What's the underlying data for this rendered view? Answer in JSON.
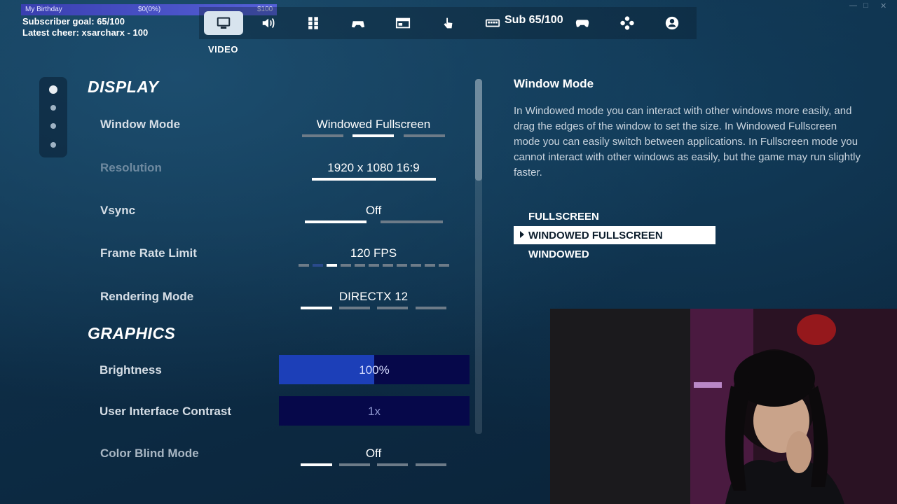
{
  "overlay": {
    "goal_bar": {
      "title": "My Birthday",
      "current": "$0(0%)",
      "target": "$100"
    },
    "subscriber_goal": "Subscriber goal: 65/100",
    "latest_cheer": "Latest cheer: xsarcharx - 100",
    "sub_counter": "Sub 65/100"
  },
  "nav": {
    "tabs": [
      {
        "icon": "monitor-icon",
        "active": true
      },
      {
        "icon": "speaker-icon",
        "active": false
      },
      {
        "icon": "accessibility-grid-icon",
        "active": false
      },
      {
        "icon": "controller-settings-icon",
        "active": false
      },
      {
        "icon": "window-layout-icon",
        "active": false
      },
      {
        "icon": "touch-icon",
        "active": false
      },
      {
        "icon": "keyboard-icon",
        "active": false
      },
      {
        "icon": "gamepad-icon",
        "active": false
      },
      {
        "icon": "dpad-icon",
        "active": false
      },
      {
        "icon": "account-icon",
        "active": false
      }
    ],
    "active_label": "VIDEO"
  },
  "sections": {
    "display": "DISPLAY",
    "graphics": "GRAPHICS"
  },
  "settings": {
    "window_mode": {
      "label": "Window Mode",
      "value": "Windowed Fullscreen",
      "options_count": 3,
      "selected_index": 1
    },
    "resolution": {
      "label": "Resolution",
      "value": "1920 x 1080 16:9"
    },
    "vsync": {
      "label": "Vsync",
      "value": "Off"
    },
    "frame_rate_limit": {
      "label": "Frame Rate Limit",
      "value": "120 FPS"
    },
    "rendering_mode": {
      "label": "Rendering Mode",
      "value": "DIRECTX 12"
    },
    "brightness": {
      "label": "Brightness",
      "value": "100%",
      "level": 0.5
    },
    "ui_contrast": {
      "label": "User Interface Contrast",
      "value": "1x"
    },
    "color_blind_mode": {
      "label": "Color Blind Mode",
      "value": "Off"
    }
  },
  "description": {
    "title": "Window Mode",
    "body": "In Windowed mode you can interact with other windows more easily, and drag the edges of the window to set the size. In Windowed Fullscreen mode you can easily switch between applications. In Fullscreen mode you cannot interact with other windows as easily, but the game may run slightly faster.",
    "options": [
      "FULLSCREEN",
      "WINDOWED FULLSCREEN",
      "WINDOWED"
    ],
    "selected": "WINDOWED FULLSCREEN"
  },
  "colors": {
    "active_tab": "#d8e4ee",
    "slider_fill": "#1c3fb8",
    "slider_bg": "#06084a",
    "goal_bar": "#4a50c8"
  }
}
